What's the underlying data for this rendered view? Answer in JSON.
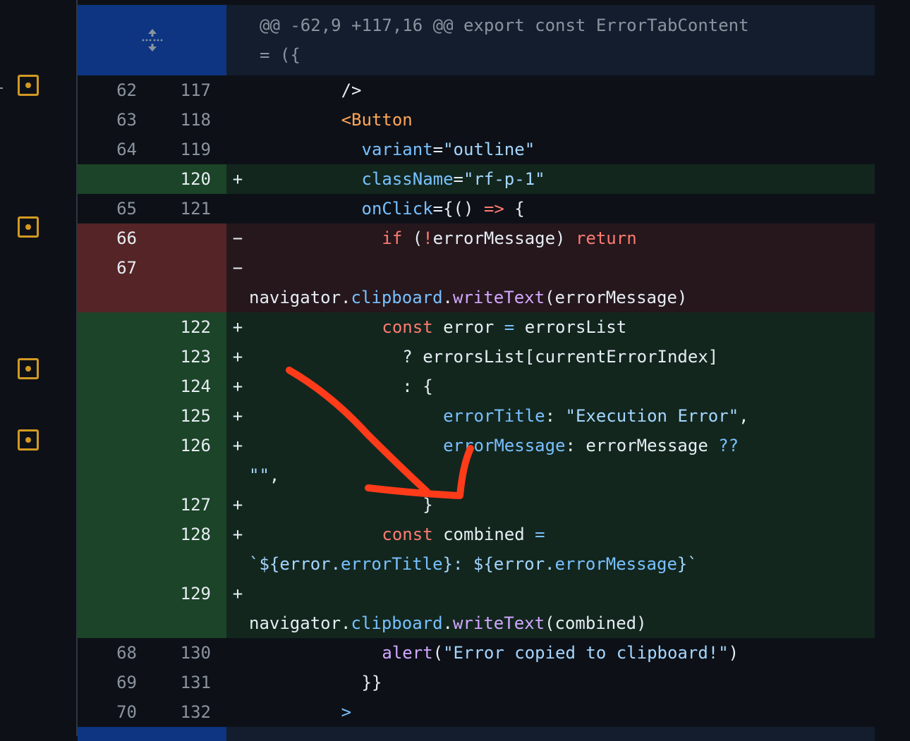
{
  "colors": {
    "marker": "#d29922",
    "annotation": "#ff3b1a",
    "added": "#1c4428",
    "deleted": "#542426",
    "hunk": "#0e3582"
  },
  "hunk_header": {
    "line1": "@@ -62,9 +117,16 @@ export const ErrorTabContent",
    "line2": "= ({",
    "icon": "expand-icon"
  },
  "rows": [
    {
      "type": "ctx",
      "old": "62",
      "new": "117",
      "lines": [
        [
          [
            "        ",
            "d"
          ],
          [
            "/>",
            "d"
          ]
        ]
      ]
    },
    {
      "type": "ctx",
      "old": "63",
      "new": "118",
      "lines": [
        [
          [
            "        ",
            "d"
          ],
          [
            "<Button",
            "t"
          ]
        ]
      ]
    },
    {
      "type": "ctx",
      "old": "64",
      "new": "119",
      "lines": [
        [
          [
            "          ",
            "d"
          ],
          [
            "variant",
            "p"
          ],
          [
            "=",
            "d"
          ],
          [
            "\"outline\"",
            "s2"
          ]
        ]
      ]
    },
    {
      "type": "add",
      "old": "",
      "new": "120",
      "lines": [
        [
          [
            "          ",
            "d"
          ],
          [
            "className",
            "p"
          ],
          [
            "=",
            "d"
          ],
          [
            "\"rf-p-1\"",
            "s2"
          ]
        ]
      ]
    },
    {
      "type": "ctx",
      "old": "65",
      "new": "121",
      "lines": [
        [
          [
            "          ",
            "d"
          ],
          [
            "onClick",
            "p"
          ],
          [
            "={() ",
            "d"
          ],
          [
            "=>",
            "k"
          ],
          [
            " {",
            "d"
          ]
        ]
      ]
    },
    {
      "type": "del",
      "old": "66",
      "new": "",
      "lines": [
        [
          [
            "            ",
            "d"
          ],
          [
            "if",
            "k"
          ],
          [
            " (",
            "d"
          ],
          [
            "!",
            "k"
          ],
          [
            "errorMessage) ",
            "d"
          ],
          [
            "return",
            "k"
          ]
        ]
      ]
    },
    {
      "type": "del",
      "old": "67",
      "new": "",
      "lines": [
        [
          [
            "",
            "d"
          ]
        ],
        [
          [
            "navigator.",
            "d"
          ],
          [
            "clipboard",
            "p"
          ],
          [
            ".",
            "d"
          ],
          [
            "writeText",
            "f"
          ],
          [
            "(errorMessage)",
            "d"
          ]
        ]
      ]
    },
    {
      "type": "add",
      "old": "",
      "new": "122",
      "lines": [
        [
          [
            "            ",
            "d"
          ],
          [
            "const",
            "k"
          ],
          [
            " error ",
            "d"
          ],
          [
            "=",
            "p"
          ],
          [
            " errorsList",
            "d"
          ]
        ]
      ]
    },
    {
      "type": "add",
      "old": "",
      "new": "123",
      "lines": [
        [
          [
            "              ? errorsList[currentErrorIndex]",
            "d"
          ]
        ]
      ]
    },
    {
      "type": "add",
      "old": "",
      "new": "124",
      "lines": [
        [
          [
            "              : {",
            "d"
          ]
        ]
      ]
    },
    {
      "type": "add",
      "old": "",
      "new": "125",
      "lines": [
        [
          [
            "                  ",
            "d"
          ],
          [
            "errorTitle",
            "p"
          ],
          [
            ": ",
            "d"
          ],
          [
            "\"Execution Error\"",
            "s2"
          ],
          [
            ",",
            "d"
          ]
        ]
      ]
    },
    {
      "type": "add",
      "old": "",
      "new": "126",
      "lines": [
        [
          [
            "                  ",
            "d"
          ],
          [
            "errorMessage",
            "p"
          ],
          [
            ": errorMessage ",
            "d"
          ],
          [
            "??",
            "p"
          ]
        ],
        [
          [
            "\"\"",
            "s2"
          ],
          [
            ",",
            "d"
          ]
        ]
      ]
    },
    {
      "type": "add",
      "old": "",
      "new": "127",
      "lines": [
        [
          [
            "                }",
            "d"
          ]
        ]
      ]
    },
    {
      "type": "add",
      "old": "",
      "new": "128",
      "lines": [
        [
          [
            "            ",
            "d"
          ],
          [
            "const",
            "k"
          ],
          [
            " combined ",
            "d"
          ],
          [
            "=",
            "p"
          ]
        ],
        [
          [
            "`${error.",
            "s2"
          ],
          [
            "errorTitle",
            "p"
          ],
          [
            "}: ${error.",
            "s2"
          ],
          [
            "errorMessage",
            "p"
          ],
          [
            "}`",
            "s2"
          ]
        ]
      ]
    },
    {
      "type": "add",
      "old": "",
      "new": "129",
      "lines": [
        [
          [
            "",
            "d"
          ]
        ],
        [
          [
            "navigator.",
            "d"
          ],
          [
            "clipboard",
            "p"
          ],
          [
            ".",
            "d"
          ],
          [
            "writeText",
            "f"
          ],
          [
            "(combined)",
            "d"
          ]
        ]
      ]
    },
    {
      "type": "ctx",
      "old": "68",
      "new": "130",
      "lines": [
        [
          [
            "            ",
            "d"
          ],
          [
            "alert",
            "f"
          ],
          [
            "(",
            "d"
          ],
          [
            "\"Error copied to clipboard!\"",
            "s2"
          ],
          [
            ")",
            "d"
          ]
        ]
      ]
    },
    {
      "type": "ctx",
      "old": "69",
      "new": "131",
      "lines": [
        [
          [
            "          }}",
            "d"
          ]
        ]
      ]
    },
    {
      "type": "ctx",
      "old": "70",
      "new": "132",
      "lines": [
        [
          [
            "        ",
            "d"
          ],
          [
            ">",
            "p"
          ]
        ]
      ]
    }
  ]
}
